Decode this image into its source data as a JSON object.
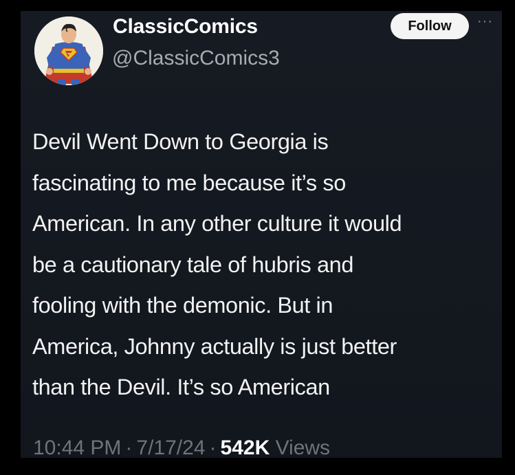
{
  "tweet": {
    "author": {
      "display_name": "ClassicComics",
      "handle": "@ClassicComics3",
      "avatar_icon": "superman-avatar-icon"
    },
    "follow_label": "Follow",
    "more_icon": "···",
    "text": "Devil Went Down to Georgia is\nfascinating to me because it’s so\nAmerican. In any other culture it would\nbe a cautionary tale of hubris and\nfooling with the demonic. But in\nAmerica, Johnny actually is just better\nthan the Devil. It’s so American",
    "meta": {
      "time": "10:44 PM",
      "separator": "·",
      "date": "7/17/24",
      "views_count": "542K",
      "views_label": "Views"
    }
  },
  "colors": {
    "card_background": "#161a22",
    "text_primary": "#f2f2f2",
    "text_secondary": "#a7abb2",
    "follow_button": "#f4f4f4"
  }
}
